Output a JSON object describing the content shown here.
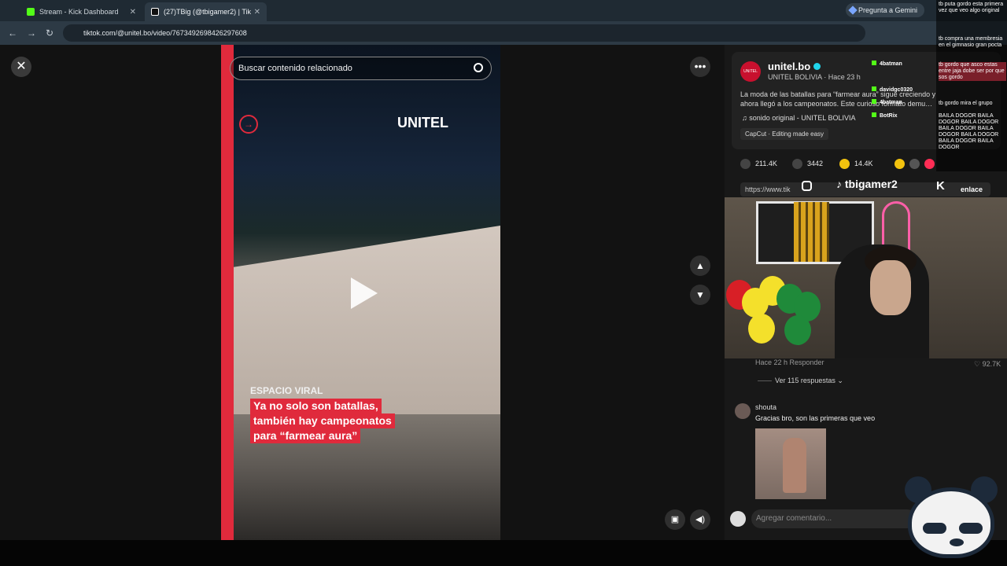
{
  "browser": {
    "tabs": [
      {
        "label": "Stream - Kick Dashboard"
      },
      {
        "label": "(27)TBig (@tbigamer2) | Tik"
      }
    ],
    "url": "tiktok.com/@unitel.bo/video/7673492698426297608",
    "gemini": "Pregunta a Gemini"
  },
  "video": {
    "search_placeholder": "Buscar contenido relacionado",
    "brand": "UNITEL",
    "espacio": "ESPACIO VIRAL",
    "caption_lines": [
      "Ya no solo son batallas,",
      "también hay campeonatos",
      "para “farmear aura”"
    ]
  },
  "post": {
    "username": "unitel.bo",
    "subline": "UNITEL BOLIVIA · Hace 23 h",
    "description": "La moda de las batallas para “farmear aura” sigue creciendo y ahora llegó a los campeonatos. Este curioso formato demu…",
    "sound": "sonido original - UNITEL BOLIVIA",
    "capcut": "CapCut · Editing made easy",
    "likes": "211.4K",
    "comments": "3442",
    "saves": "14.4K",
    "link": "https://www.tik",
    "copy_link": "enlace"
  },
  "stream_overlay": {
    "tiktok_handle": "tbigamer2",
    "kick_users": [
      {
        "name": "4batman"
      },
      {
        "name": "davidgc0320"
      },
      {
        "name": "4batman"
      },
      {
        "name": "BotRix"
      }
    ],
    "chat": [
      "tb puta gordo esta primera vez que veo algo original",
      "tb compra una membresia en el gimnasio gran pocta",
      "tb gordo que asco estas entre jaja dobe ser por que sos gordo",
      "tb gordo mira el grupo",
      "BAILA DOGOR BAILA DOGOR BAILA DOGOR BAILA DOGOR BAILA DOGOR BAILA DOGOR BAILA DOGOR BAILA DOGOR"
    ]
  },
  "comments": {
    "reply_meta": "Hace 22 h    Responder",
    "reply_likes": "92.7K",
    "view_replies": "Ver 115 respuestas",
    "comment_user": "shouta",
    "comment_text": "Gracias bro, son las primeras que veo",
    "input_placeholder": "Agregar comentario..."
  }
}
